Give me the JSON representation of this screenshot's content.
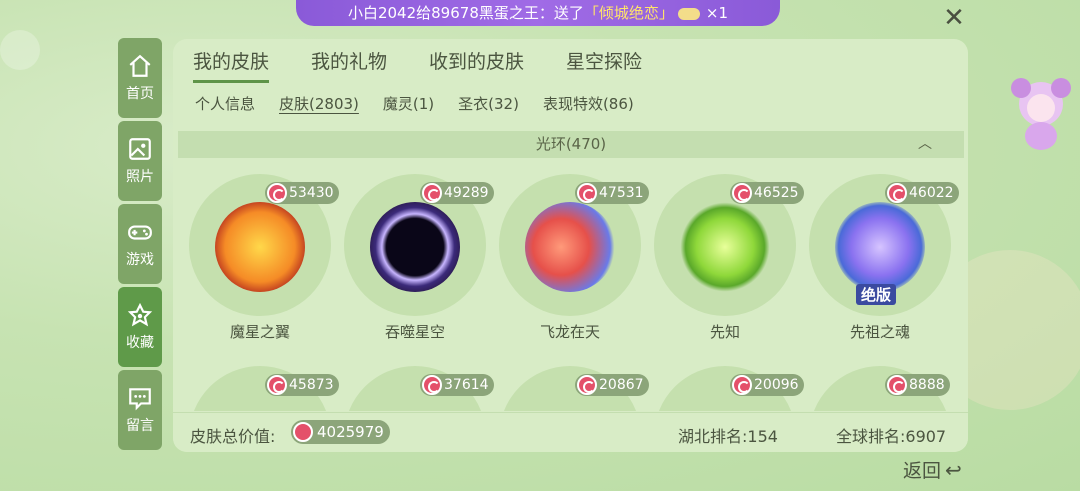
{
  "banner": {
    "prefix": "小白2042给89678黑蛋之王：送了",
    "gift": "「倾城绝恋」",
    "count": "×1"
  },
  "sidebar": [
    {
      "label": "首页",
      "icon": "home-icon"
    },
    {
      "label": "照片",
      "icon": "photo-icon"
    },
    {
      "label": "游戏",
      "icon": "gamepad-icon"
    },
    {
      "label": "收藏",
      "icon": "favorite-icon",
      "active": true
    },
    {
      "label": "留言",
      "icon": "message-icon"
    }
  ],
  "tabs": [
    "我的皮肤",
    "我的礼物",
    "收到的皮肤",
    "星空探险"
  ],
  "subtabs": [
    "个人信息",
    "皮肤(2803)",
    "魔灵(1)",
    "圣衣(32)",
    "表现特效(86)"
  ],
  "section": {
    "title": "光环(470)"
  },
  "items": [
    {
      "name": "魔星之翼",
      "value": "53430",
      "color": "#f07a2a"
    },
    {
      "name": "吞噬星空",
      "value": "49289",
      "color": "#1a1030"
    },
    {
      "name": "飞龙在天",
      "value": "47531",
      "color": "#e85b4a"
    },
    {
      "name": "先知",
      "value": "46525",
      "color": "#8bd84a"
    },
    {
      "name": "先祖之魂",
      "value": "46022",
      "color": "#6c7ae0",
      "ribbon": "绝版"
    }
  ],
  "items_row2": [
    {
      "value": "45873"
    },
    {
      "value": "37614"
    },
    {
      "value": "20867"
    },
    {
      "value": "20096"
    },
    {
      "value": "8888"
    }
  ],
  "footer": {
    "total_label": "皮肤总价值:",
    "total_value": "4025979",
    "rank_hubei": "湖北排名:154",
    "rank_global": "全球排名:6907"
  },
  "back_label": "返回",
  "colors": {
    "accent": "#5f9a49",
    "banner": "#9a66e2",
    "coin": "#e4506a"
  }
}
